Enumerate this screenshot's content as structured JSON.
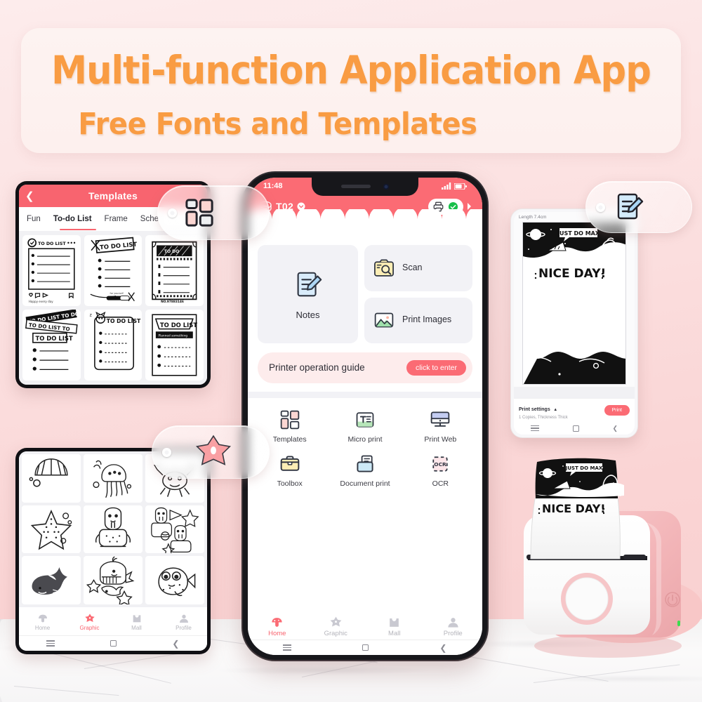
{
  "headline": {
    "line1": "Multi-function Application App",
    "line2": "Free Fonts and Templates",
    "accent_color": "#f99c43",
    "card_bg": "#fdf3f1"
  },
  "theme": {
    "brand_pink": "#fb6b74",
    "soft_pink_bg": "#fdecec",
    "card_grey": "#f2f2f6",
    "muted_text": "#b4b4bb"
  },
  "templates_tablet": {
    "back_icon": "chevron-left-icon",
    "title": "Templates",
    "tabs": [
      {
        "label": "Fun",
        "active": false
      },
      {
        "label": "To-do List",
        "active": true
      },
      {
        "label": "Frame",
        "active": false
      },
      {
        "label": "Sche",
        "active": false
      }
    ],
    "thumbnails": [
      {
        "caption": "TO DO LIST",
        "style": "social-post"
      },
      {
        "caption": "TO DO LIST",
        "style": "tape-banner"
      },
      {
        "caption": "TO DO LIST",
        "style": "ticket-frame"
      },
      {
        "caption": "TO DO LIST",
        "style": "stacked-tape"
      },
      {
        "caption": "TO DO LIST",
        "style": "cat-corner"
      },
      {
        "caption": "TO DO LIST",
        "style": "banner-dotted"
      }
    ]
  },
  "graphic_tablet": {
    "thumbnails": [
      {
        "name": "scallop-shell"
      },
      {
        "name": "jellyfish"
      },
      {
        "name": "crab"
      },
      {
        "name": "starfish"
      },
      {
        "name": "walrus"
      },
      {
        "name": "walrus-pair"
      },
      {
        "name": "shark"
      },
      {
        "name": "whale"
      },
      {
        "name": "pufferfish"
      }
    ],
    "nav": [
      {
        "label": "Home",
        "icon": "mushroom-icon",
        "active": false
      },
      {
        "label": "Graphic",
        "icon": "star-icon",
        "active": true
      },
      {
        "label": "Mall",
        "icon": "bag-icon",
        "active": false
      },
      {
        "label": "Profile",
        "icon": "person-icon",
        "active": false
      }
    ]
  },
  "main_phone": {
    "status_bar": {
      "time": "11:48",
      "signal_icon": "signal-icon",
      "battery_icon": "battery-icon"
    },
    "device": {
      "icon": "printer-device-icon",
      "name": "T02",
      "dropdown_icon": "chevron-down-icon",
      "printer_icon": "printer-icon",
      "status_icon": "check-circle-icon",
      "arrow_icon": "chevron-right-icon"
    },
    "primary_cards": [
      {
        "label": "Notes",
        "icon": "notes-icon"
      },
      {
        "label": "Scan",
        "icon": "scan-icon"
      },
      {
        "label": "Print Images",
        "icon": "image-icon"
      }
    ],
    "guide_banner": {
      "text": "Printer operation guide",
      "button_label": "click to enter"
    },
    "features": [
      {
        "label": "Templates",
        "icon": "grid-icon"
      },
      {
        "label": "Micro print",
        "icon": "micro-print-icon"
      },
      {
        "label": "Print Web",
        "icon": "monitor-icon"
      },
      {
        "label": "Toolbox",
        "icon": "toolbox-icon"
      },
      {
        "label": "Document print",
        "icon": "document-print-icon"
      },
      {
        "label": "OCR",
        "icon": "ocr-icon"
      }
    ],
    "nav": [
      {
        "label": "Home",
        "icon": "mushroom-icon",
        "active": true
      },
      {
        "label": "Graphic",
        "icon": "star-icon",
        "active": false
      },
      {
        "label": "Mall",
        "icon": "bag-icon",
        "active": false
      },
      {
        "label": "Profile",
        "icon": "person-icon",
        "active": false
      }
    ]
  },
  "preview_phone": {
    "length_label": "Length 7.4cm",
    "label_text": "NICE DAY!",
    "bubble_text": "JUST DO MAX",
    "print_settings": {
      "title": "Print settings",
      "collapse_icon": "chevron-up-icon",
      "summary": "1 Copies, Thickness Thick",
      "button_label": "Print"
    }
  },
  "printer": {
    "name": "thermal-label-printer",
    "paper_text": "NICE DAY!",
    "paper_bubble_text": "JUST DO MAX",
    "power_icon": "power-icon",
    "led_color": "#3ddb4e",
    "body_color": "#f5bfc1",
    "face_color": "#ffffff"
  },
  "badges": [
    {
      "id": "templates",
      "icon": "grid-icon",
      "name": "templates-badge"
    },
    {
      "id": "notes",
      "icon": "notes-icon",
      "name": "notes-badge"
    },
    {
      "id": "graphic",
      "icon": "star-icon",
      "name": "graphic-badge"
    }
  ]
}
